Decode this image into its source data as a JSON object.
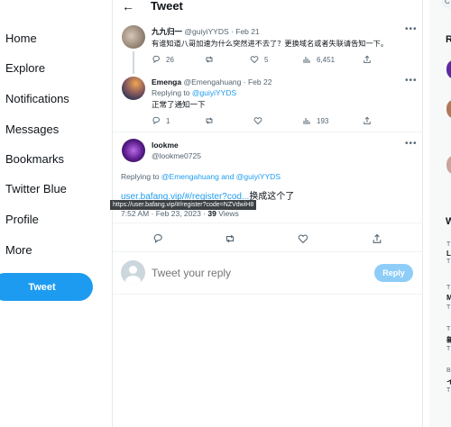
{
  "nav": {
    "items": [
      "Home",
      "Explore",
      "Notifications",
      "Messages",
      "Bookmarks",
      "Twitter Blue",
      "Profile",
      "More"
    ],
    "tweet_button": "Tweet"
  },
  "header": {
    "back": "←",
    "title": "Tweet"
  },
  "tweets": [
    {
      "name": "九九归一",
      "handle": "@guiyiYYDS",
      "sep": "·",
      "date": "Feb 21",
      "text": "有谁知道八哥加速为什么突然进不去了？更换域名或者失联请告知一下。",
      "stats": {
        "replies": "26",
        "retweets": "",
        "likes": "5",
        "views": "6,451"
      }
    },
    {
      "name": "Emenga",
      "handle": "@Emengahuang",
      "sep": "·",
      "date": "Feb 22",
      "replying_prefix": "Replying to",
      "replying_to": "@guiyiYYDS",
      "text": "正常了通知一下",
      "stats": {
        "replies": "1",
        "retweets": "",
        "likes": "",
        "views": "193"
      }
    }
  ],
  "focus_tweet": {
    "name": "lookme",
    "handle": "@lookme0725",
    "replying_prefix": "Replying to",
    "replying_to": "@Emengahuang and @guiyiYYDS",
    "link_text": "user.bafang.vip/#/register?cod...",
    "text_after": "换成这个了",
    "time": "7:52 AM · Feb 23, 2023 ·",
    "views_count": "39",
    "views_label": "Views",
    "tooltip": "https://user.bafang.vip/#/register?code=NZVdwiH8"
  },
  "reply_box": {
    "placeholder": "Tweet your reply",
    "button": "Reply"
  },
  "right": {
    "top_partial": "C",
    "r_letter": "R",
    "w_letter": "W",
    "snippets": [
      "T",
      "L",
      "T",
      "T",
      "M",
      "T",
      "T",
      "新",
      "T",
      "B",
      "イ",
      "T"
    ]
  }
}
